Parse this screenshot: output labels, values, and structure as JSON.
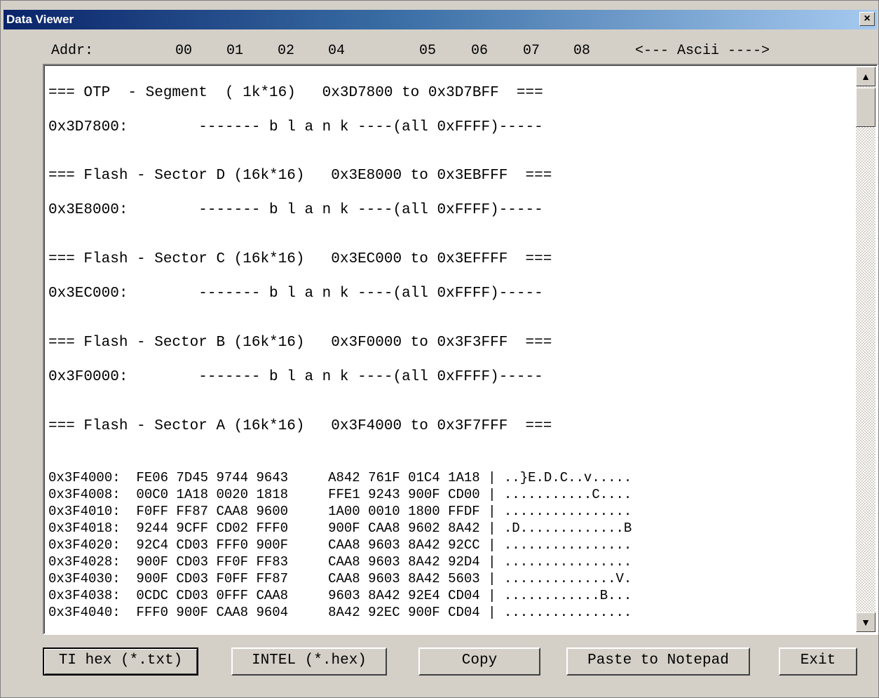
{
  "window": {
    "title": "Data Viewer",
    "close_icon": "close-icon",
    "close_glyph": "×"
  },
  "column_header": {
    "addr": "Addr:",
    "cols": [
      "00",
      "01",
      "02",
      "04",
      "05",
      "06",
      "07",
      "08"
    ],
    "ascii": "<--- Ascii ---->"
  },
  "sections": [
    {
      "header": "=== OTP  - Segment  ( 1k*16)   0x3D7800 to 0x3D7BFF  ===",
      "blank": "0x3D7800:        ------- b l a n k ----(all 0xFFFF)-----"
    },
    {
      "header": "=== Flash - Sector D (16k*16)   0x3E8000 to 0x3EBFFF  ===",
      "blank": "0x3E8000:        ------- b l a n k ----(all 0xFFFF)-----"
    },
    {
      "header": "=== Flash - Sector C (16k*16)   0x3EC000 to 0x3EFFFF  ===",
      "blank": "0x3EC000:        ------- b l a n k ----(all 0xFFFF)-----"
    },
    {
      "header": "=== Flash - Sector B (16k*16)   0x3F0000 to 0x3F3FFF  ===",
      "blank": "0x3F0000:        ------- b l a n k ----(all 0xFFFF)-----"
    },
    {
      "header": "=== Flash - Sector A (16k*16)   0x3F4000 to 0x3F7FFF  ==="
    }
  ],
  "data_rows": [
    "0x3F4000:  FE06 7D45 9744 9643     A842 761F 01C4 1A18 | ..}E.D.C..v.....",
    "0x3F4008:  00C0 1A18 0020 1818     FFE1 9243 900F CD00 | ...........C....",
    "0x3F4010:  F0FF FF87 CAA8 9600     1A00 0010 1800 FFDF | ................",
    "0x3F4018:  9244 9CFF CD02 FFF0     900F CAA8 9602 8A42 | .D.............B",
    "0x3F4020:  92C4 CD03 FFF0 900F     CAA8 9603 8A42 92CC | ................",
    "0x3F4028:  900F CD03 FF0F FF83     CAA8 9603 8A42 92D4 | ................",
    "0x3F4030:  900F CD03 F0FF FF87     CAA8 9603 8A42 5603 | ..............V.",
    "0x3F4038:  0CDC CD03 0FFF CAA8     9603 8A42 92E4 CD04 | ............B...",
    "0x3F4040:  FFF0 900F CAA8 9604     8A42 92EC 900F CD04 | ................"
  ],
  "scrollbar": {
    "up_glyph": "▲",
    "down_glyph": "▼"
  },
  "buttons": {
    "ti_hex": "TI hex (*.txt)",
    "intel": "INTEL (*.hex)",
    "copy": "Copy",
    "paste": "Paste to Notepad",
    "exit": "Exit"
  },
  "colors": {
    "title_start": "#0a246a",
    "title_end": "#a6caf0",
    "face": "#d4d0c8"
  }
}
